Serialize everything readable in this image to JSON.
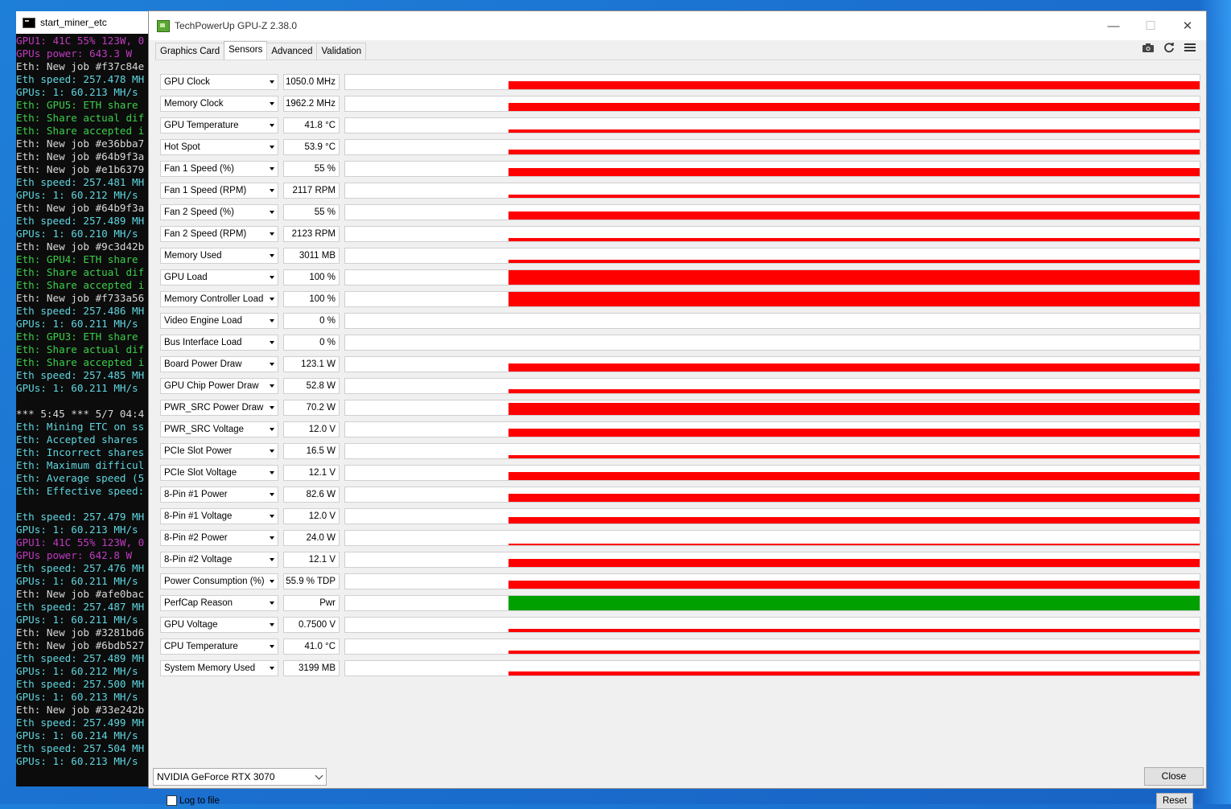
{
  "terminal": {
    "title": "start_miner_etc",
    "lines": [
      {
        "text": "GPU1: 41C 55% 123W, 0",
        "color": "magenta"
      },
      {
        "text": "GPUs power: 643.3 W",
        "color": "magenta"
      },
      {
        "text": "Eth: New job #f37c84e",
        "color": "white"
      },
      {
        "text": "Eth speed: 257.478 MH",
        "color": "cyan"
      },
      {
        "text": "GPUs: 1: 60.213 MH/s",
        "color": "cyan"
      },
      {
        "text": "Eth: GPU5: ETH share",
        "color": "green"
      },
      {
        "text": "Eth: Share actual dif",
        "color": "green"
      },
      {
        "text": "Eth: Share accepted i",
        "color": "green"
      },
      {
        "text": "Eth: New job #e36bba7",
        "color": "white"
      },
      {
        "text": "Eth: New job #64b9f3a",
        "color": "white"
      },
      {
        "text": "Eth: New job #e1b6379",
        "color": "white"
      },
      {
        "text": "Eth speed: 257.481 MH",
        "color": "cyan"
      },
      {
        "text": "GPUs: 1: 60.212 MH/s",
        "color": "cyan"
      },
      {
        "text": "Eth: New job #64b9f3a",
        "color": "white"
      },
      {
        "text": "Eth speed: 257.489 MH",
        "color": "cyan"
      },
      {
        "text": "GPUs: 1: 60.210 MH/s",
        "color": "cyan"
      },
      {
        "text": "Eth: New job #9c3d42b",
        "color": "white"
      },
      {
        "text": "Eth: GPU4: ETH share",
        "color": "green"
      },
      {
        "text": "Eth: Share actual dif",
        "color": "green"
      },
      {
        "text": "Eth: Share accepted i",
        "color": "green"
      },
      {
        "text": "Eth: New job #f733a56",
        "color": "white"
      },
      {
        "text": "Eth speed: 257.486 MH",
        "color": "cyan"
      },
      {
        "text": "GPUs: 1: 60.211 MH/s",
        "color": "cyan"
      },
      {
        "text": "Eth: GPU3: ETH share",
        "color": "green"
      },
      {
        "text": "Eth: Share actual dif",
        "color": "green"
      },
      {
        "text": "Eth: Share accepted i",
        "color": "green"
      },
      {
        "text": "Eth speed: 257.485 MH",
        "color": "cyan"
      },
      {
        "text": "GPUs: 1: 60.211 MH/s",
        "color": "cyan"
      },
      {
        "text": "",
        "color": "white"
      },
      {
        "text": "*** 5:45 *** 5/7 04:4",
        "color": "white"
      },
      {
        "text": "Eth: Mining ETC on ss",
        "color": "cyan"
      },
      {
        "text": "Eth: Accepted shares",
        "color": "cyan"
      },
      {
        "text": "Eth: Incorrect shares",
        "color": "cyan"
      },
      {
        "text": "Eth: Maximum difficul",
        "color": "cyan"
      },
      {
        "text": "Eth: Average speed (5",
        "color": "cyan"
      },
      {
        "text": "Eth: Effective speed:",
        "color": "cyan"
      },
      {
        "text": "",
        "color": "white"
      },
      {
        "text": "Eth speed: 257.479 MH",
        "color": "cyan"
      },
      {
        "text": "GPUs: 1: 60.213 MH/s",
        "color": "cyan"
      },
      {
        "text": "GPU1: 41C 55% 123W, 0",
        "color": "magenta"
      },
      {
        "text": "GPUs power: 642.8 W",
        "color": "magenta"
      },
      {
        "text": "Eth speed: 257.476 MH",
        "color": "cyan"
      },
      {
        "text": "GPUs: 1: 60.211 MH/s",
        "color": "cyan"
      },
      {
        "text": "Eth: New job #afe0bac",
        "color": "white"
      },
      {
        "text": "Eth speed: 257.487 MH",
        "color": "cyan"
      },
      {
        "text": "GPUs: 1: 60.211 MH/s",
        "color": "cyan"
      },
      {
        "text": "Eth: New job #3281bd6",
        "color": "white"
      },
      {
        "text": "Eth: New job #6bdb527",
        "color": "white"
      },
      {
        "text": "Eth speed: 257.489 MH",
        "color": "cyan"
      },
      {
        "text": "GPUs: 1: 60.212 MH/s",
        "color": "cyan"
      },
      {
        "text": "Eth speed: 257.500 MH",
        "color": "cyan"
      },
      {
        "text": "GPUs: 1: 60.213 MH/s",
        "color": "cyan"
      },
      {
        "text": "Eth: New job #33e242b",
        "color": "white"
      },
      {
        "text": "Eth speed: 257.499 MH",
        "color": "cyan"
      },
      {
        "text": "GPUs: 1: 60.214 MH/s",
        "color": "cyan"
      },
      {
        "text": "Eth speed: 257.504 MH",
        "color": "cyan"
      },
      {
        "text": "GPUs: 1: 60.213 MH/s",
        "color": "cyan"
      }
    ]
  },
  "window": {
    "title": "TechPowerUp GPU-Z 2.38.0",
    "minimize": "—",
    "maximize": "☐",
    "close": "✕"
  },
  "tabs": [
    {
      "label": "Graphics Card",
      "active": false
    },
    {
      "label": "Sensors",
      "active": true
    },
    {
      "label": "Advanced",
      "active": false
    },
    {
      "label": "Validation",
      "active": false
    }
  ],
  "toolbar": {
    "camera_icon": "camera-icon",
    "refresh_icon": "refresh-icon",
    "menu_icon": "hamburger-menu-icon"
  },
  "graph_colors": {
    "red": "#ff0000",
    "green": "#00a000"
  },
  "sensors": [
    {
      "label": "GPU Clock",
      "value": "1050.0 MHz",
      "level": 0.55,
      "color": "red",
      "jitter": true
    },
    {
      "label": "Memory Clock",
      "value": "1962.2 MHz",
      "level": 0.55,
      "color": "red",
      "jitter": false
    },
    {
      "label": "GPU Temperature",
      "value": "41.8 °C",
      "level": 0.2,
      "color": "red",
      "jitter": false
    },
    {
      "label": "Hot Spot",
      "value": "53.9 °C",
      "level": 0.35,
      "color": "red",
      "jitter": false
    },
    {
      "label": "Fan 1 Speed (%)",
      "value": "55 %",
      "level": 0.55,
      "color": "red",
      "jitter": false
    },
    {
      "label": "Fan 1 Speed (RPM)",
      "value": "2117 RPM",
      "level": 0.2,
      "color": "red",
      "jitter": false
    },
    {
      "label": "Fan 2 Speed (%)",
      "value": "55 %",
      "level": 0.55,
      "color": "red",
      "jitter": false
    },
    {
      "label": "Fan 2 Speed (RPM)",
      "value": "2123 RPM",
      "level": 0.2,
      "color": "red",
      "jitter": false
    },
    {
      "label": "Memory Used",
      "value": "3011 MB",
      "level": 0.2,
      "color": "red",
      "jitter": false
    },
    {
      "label": "GPU Load",
      "value": "100 %",
      "level": 1.0,
      "color": "red",
      "jitter": false
    },
    {
      "label": "Memory Controller Load",
      "value": "100 %",
      "level": 1.0,
      "color": "red",
      "jitter": false
    },
    {
      "label": "Video Engine Load",
      "value": "0 %",
      "level": 0,
      "color": "red",
      "jitter": false
    },
    {
      "label": "Bus Interface Load",
      "value": "0 %",
      "level": 0,
      "color": "red",
      "jitter": false
    },
    {
      "label": "Board Power Draw",
      "value": "123.1 W",
      "level": 0.55,
      "color": "red",
      "jitter": false
    },
    {
      "label": "GPU Chip Power Draw",
      "value": "52.8 W",
      "level": 0.25,
      "color": "red",
      "jitter": false
    },
    {
      "label": "PWR_SRC Power Draw",
      "value": "70.2 W",
      "level": 0.85,
      "color": "red",
      "jitter": false
    },
    {
      "label": "PWR_SRC Voltage",
      "value": "12.0 V",
      "level": 0.55,
      "color": "red",
      "jitter": false
    },
    {
      "label": "PCIe Slot Power",
      "value": "16.5 W",
      "level": 0.2,
      "color": "red",
      "jitter": false
    },
    {
      "label": "PCIe Slot Voltage",
      "value": "12.1 V",
      "level": 0.55,
      "color": "red",
      "jitter": false
    },
    {
      "label": "8-Pin #1 Power",
      "value": "82.6 W",
      "level": 0.55,
      "color": "red",
      "jitter": false
    },
    {
      "label": "8-Pin #1 Voltage",
      "value": "12.0 V",
      "level": 0.45,
      "color": "red",
      "jitter": false
    },
    {
      "label": "8-Pin #2 Power",
      "value": "24.0 W",
      "level": 0.12,
      "color": "red",
      "jitter": false
    },
    {
      "label": "8-Pin #2 Voltage",
      "value": "12.1 V",
      "level": 0.55,
      "color": "red",
      "jitter": false
    },
    {
      "label": "Power Consumption (%)",
      "value": "55.9 % TDP",
      "level": 0.55,
      "color": "red",
      "jitter": false
    },
    {
      "label": "PerfCap Reason",
      "value": "Pwr",
      "level": 1.0,
      "color": "green",
      "jitter": false
    },
    {
      "label": "GPU Voltage",
      "value": "0.7500 V",
      "level": 0.2,
      "color": "red",
      "jitter": false
    },
    {
      "label": "CPU Temperature",
      "value": "41.0 °C",
      "level": 0.2,
      "color": "red",
      "jitter": true
    },
    {
      "label": "System Memory Used",
      "value": "3199 MB",
      "level": 0.25,
      "color": "red",
      "jitter": false
    }
  ],
  "log_to_file": {
    "label": "Log to file",
    "checked": false
  },
  "reset_label": "Reset",
  "gpu_select": {
    "value": "NVIDIA GeForce RTX 3070"
  },
  "close_label": "Close"
}
